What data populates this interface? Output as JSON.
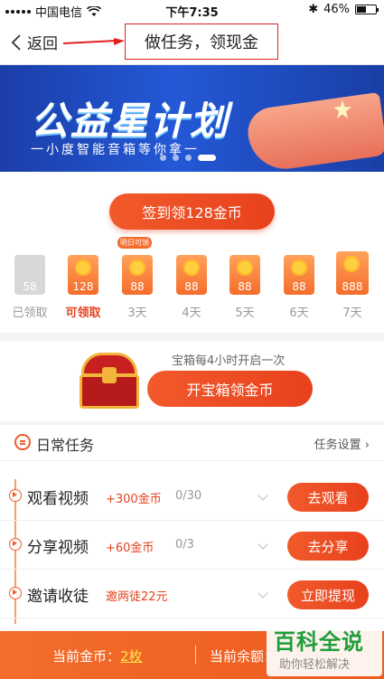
{
  "status_bar": {
    "carrier": "中国电信",
    "time": "下午7:35",
    "battery": "46%"
  },
  "nav": {
    "back_label": "返回",
    "title": "做任务，领现金"
  },
  "banner": {
    "headline": "公益星计划",
    "subtitle": "一小度智能音箱等你拿一",
    "slide_count": 4,
    "active_slide": 4
  },
  "sign_in": {
    "button_label": "签到领128金币",
    "tomorrow_tag": "明日可领",
    "days": [
      {
        "amount": "58",
        "label": "已领取",
        "state": "claimed"
      },
      {
        "amount": "128",
        "label": "可领取",
        "state": "available"
      },
      {
        "amount": "88",
        "label": "3天",
        "state": "upcoming"
      },
      {
        "amount": "88",
        "label": "4天",
        "state": "upcoming"
      },
      {
        "amount": "88",
        "label": "5天",
        "state": "upcoming"
      },
      {
        "amount": "88",
        "label": "6天",
        "state": "upcoming"
      },
      {
        "amount": "888",
        "label": "7天",
        "state": "upcoming"
      }
    ]
  },
  "treasure": {
    "hint": "宝箱每4小时开启一次",
    "button_label": "开宝箱领金币"
  },
  "tasks": {
    "title": "日常任务",
    "settings_label": "任务设置 ›",
    "items": [
      {
        "name": "观看视频",
        "reward": "+300金币",
        "progress": "0/30",
        "action": "去观看"
      },
      {
        "name": "分享视频",
        "reward": "+60金币",
        "progress": "0/3",
        "action": "去分享"
      },
      {
        "name": "邀请收徒",
        "reward": "邀两徒22元",
        "progress": "",
        "action": "立即提现"
      }
    ]
  },
  "bottom_bar": {
    "coins_label": "当前金币：",
    "coins_value": "2枚",
    "balance_label": "当前余额："
  },
  "watermark": {
    "big": "百科全说",
    "small": "助你轻松解决"
  },
  "colors": {
    "accent": "#e8411d",
    "banner_blue": "#2458d6",
    "watermark_green": "#1f9e3a"
  }
}
